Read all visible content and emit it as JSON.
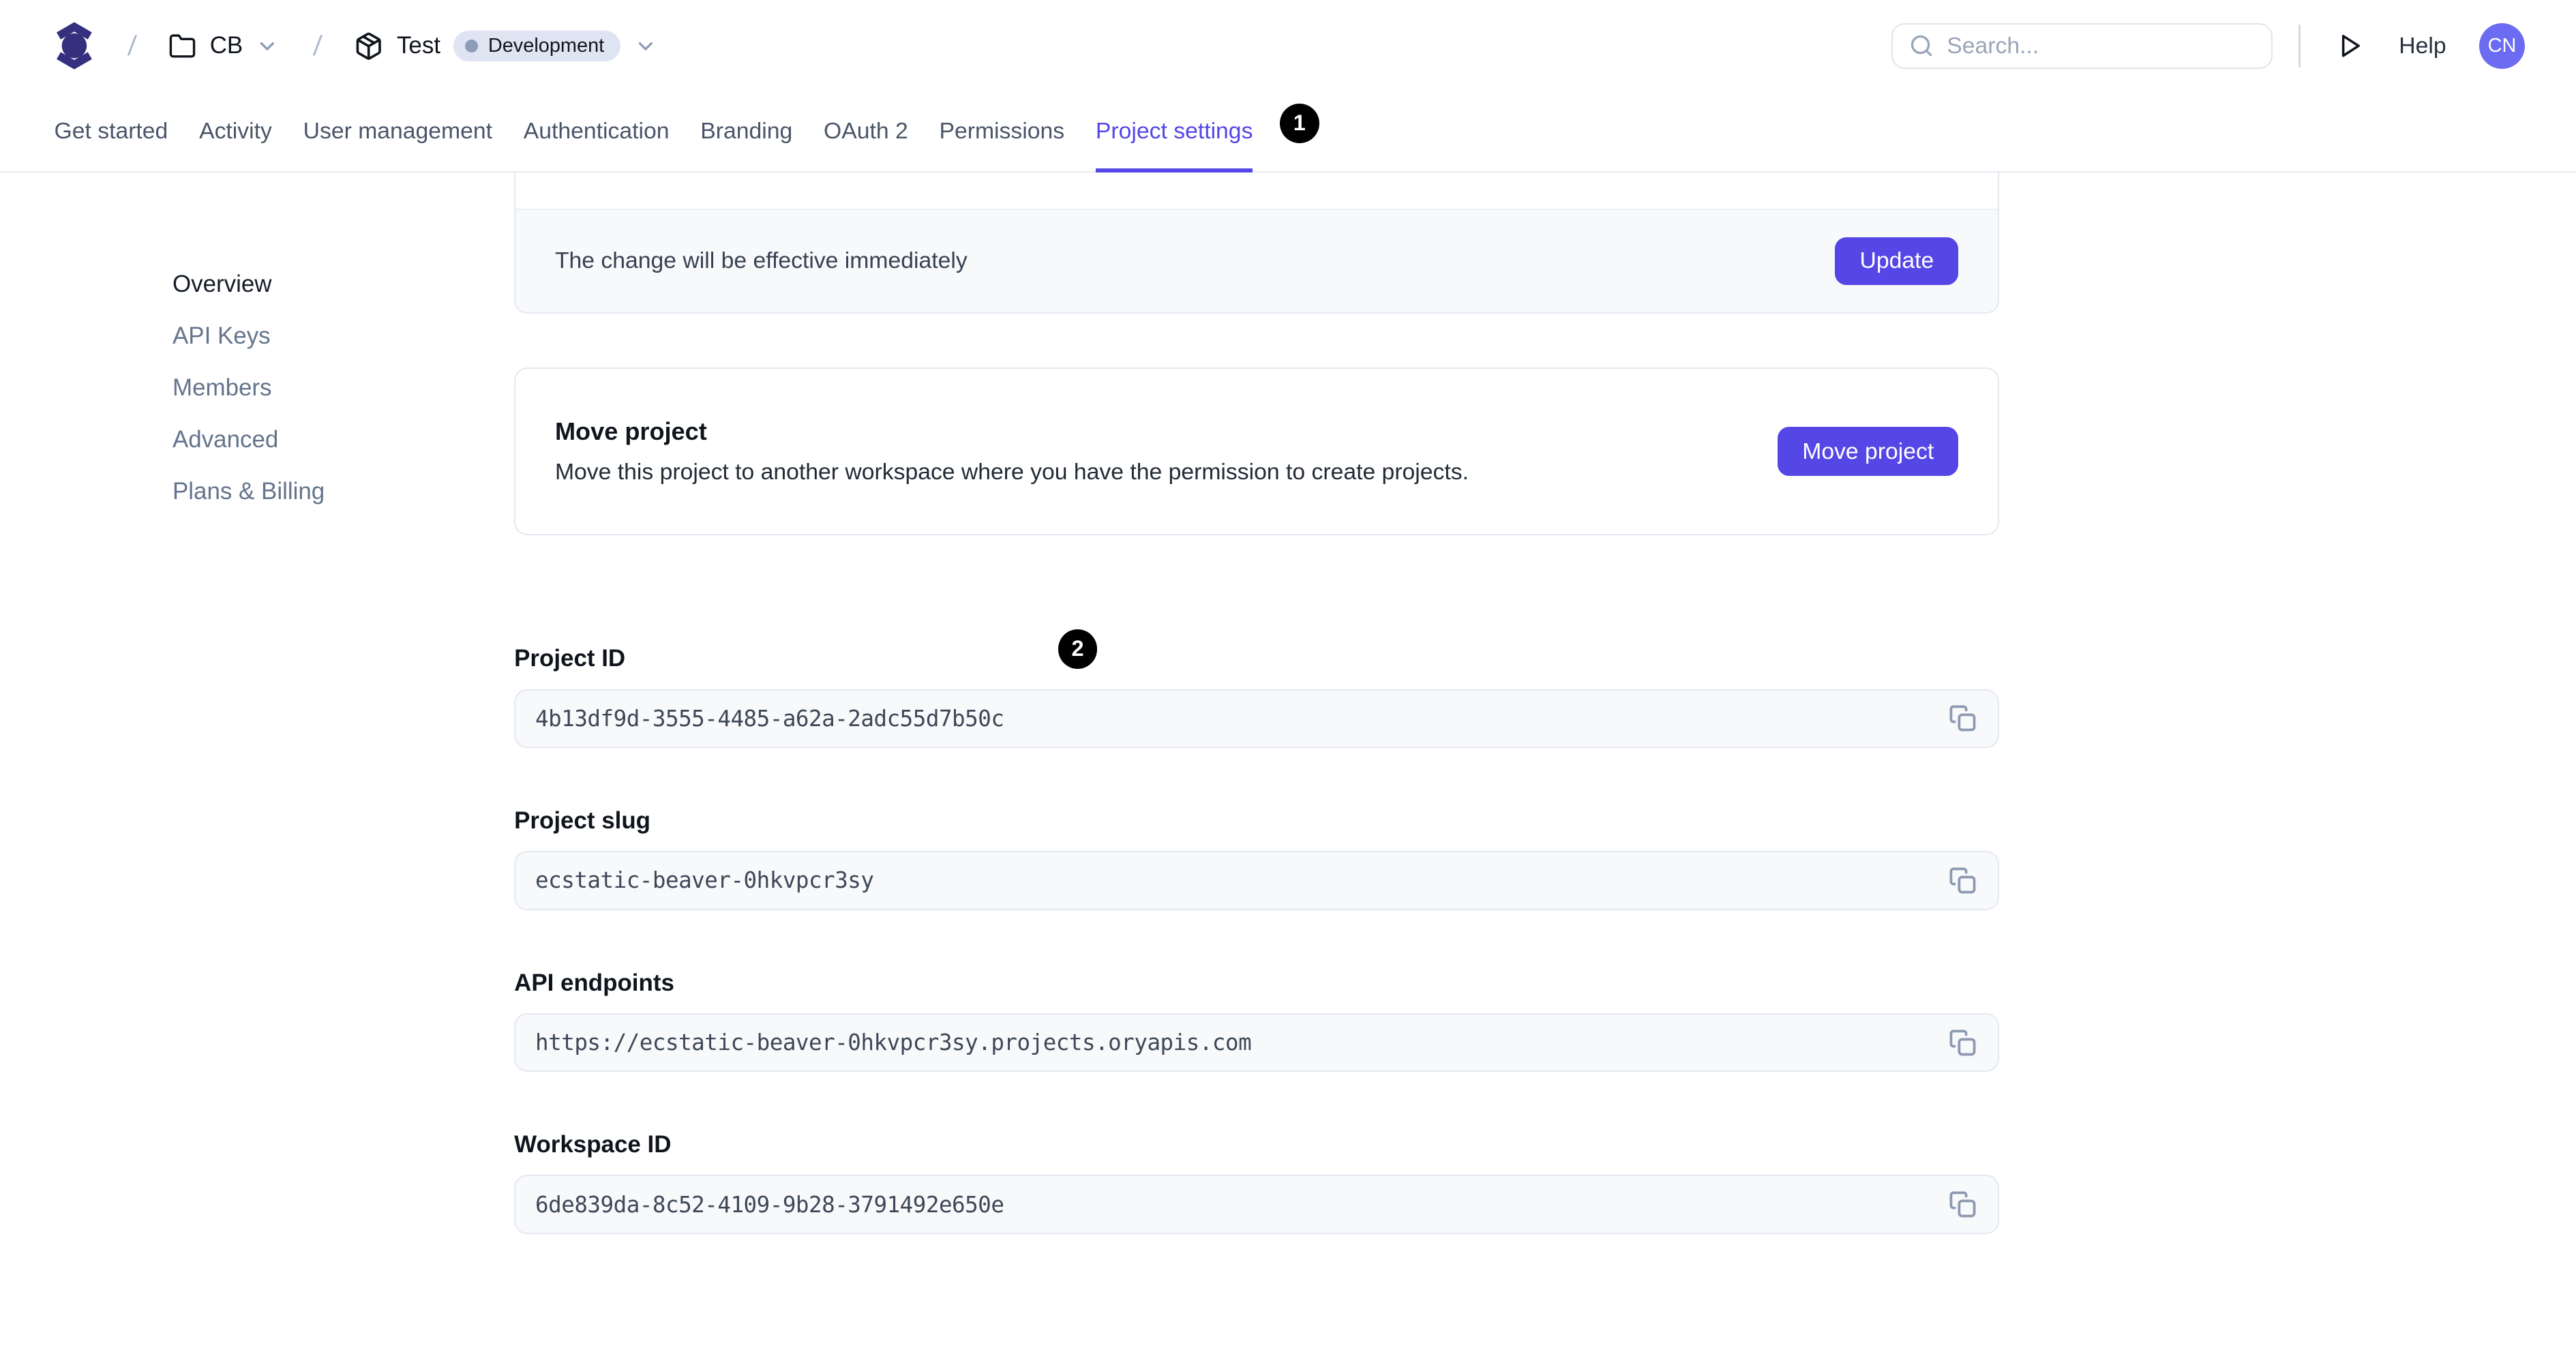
{
  "header": {
    "breadcrumb": {
      "separator": "/",
      "workspace": {
        "label": "CB",
        "icon": "folder-icon"
      },
      "project": {
        "label": "Test",
        "icon": "package-icon",
        "env_badge": "Development"
      }
    },
    "search": {
      "placeholder": "Search...",
      "icon": "search-icon"
    },
    "run_icon": "play-icon",
    "help_label": "Help",
    "avatar_initials": "CN"
  },
  "tabs": {
    "items": [
      {
        "label": "Get started",
        "active": false
      },
      {
        "label": "Activity",
        "active": false
      },
      {
        "label": "User management",
        "active": false
      },
      {
        "label": "Authentication",
        "active": false
      },
      {
        "label": "Branding",
        "active": false
      },
      {
        "label": "OAuth 2",
        "active": false
      },
      {
        "label": "Permissions",
        "active": false
      },
      {
        "label": "Project settings",
        "active": true
      }
    ]
  },
  "annotations": {
    "badge1": "1",
    "badge2": "2"
  },
  "sidebar": {
    "items": [
      {
        "label": "Overview",
        "active": true
      },
      {
        "label": "API Keys",
        "active": false
      },
      {
        "label": "Members",
        "active": false
      },
      {
        "label": "Advanced",
        "active": false
      },
      {
        "label": "Plans & Billing",
        "active": false
      }
    ]
  },
  "main": {
    "update_card": {
      "note": "The change will be effective immediately",
      "button": "Update"
    },
    "move_card": {
      "title": "Move project",
      "description": "Move this project to another workspace where you have the permission to create projects.",
      "button": "Move project"
    },
    "fields": [
      {
        "label": "Project ID",
        "value": "4b13df9d-3555-4485-a62a-2adc55d7b50c",
        "icon": "copy-icon"
      },
      {
        "label": "Project slug",
        "value": "ecstatic-beaver-0hkvpcr3sy",
        "icon": "copy-icon"
      },
      {
        "label": "API endpoints",
        "value": "https://ecstatic-beaver-0hkvpcr3sy.projects.oryapis.com",
        "icon": "copy-icon"
      },
      {
        "label": "Workspace ID",
        "value": "6de839da-8c52-4109-9b28-3791492e650e",
        "icon": "copy-icon"
      }
    ]
  },
  "colors": {
    "accent": "#5546E6",
    "logo": "#34307E",
    "avatar": "#6B6CF1",
    "badge_bg": "#DEE4F1",
    "badge_dot": "#8E9DB7",
    "annotation_bg": "#000000",
    "input_bg": "#F8F9FB",
    "border": "#E4E8F0"
  }
}
